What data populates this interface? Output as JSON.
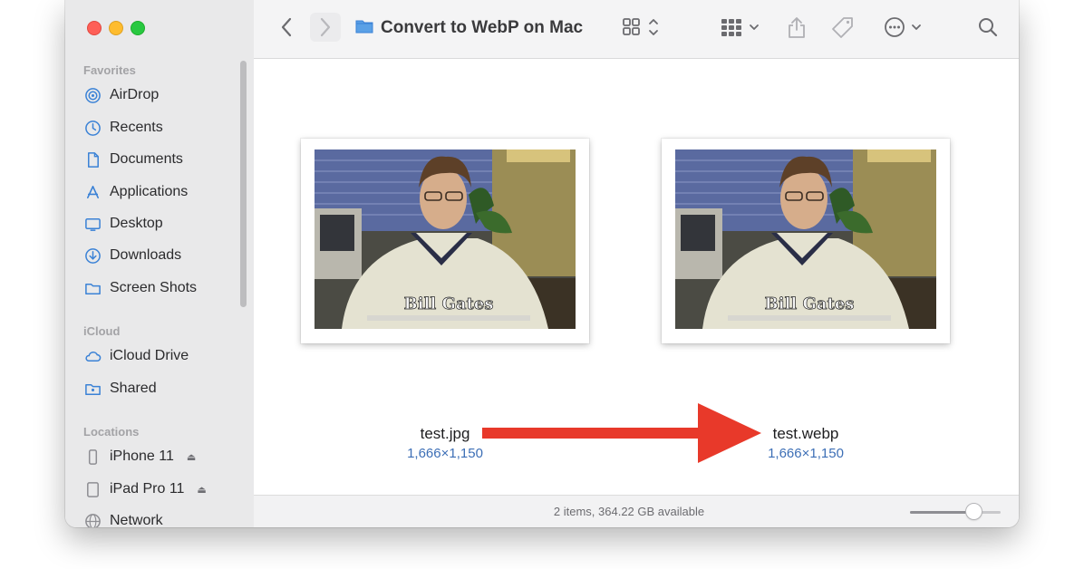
{
  "window": {
    "title": "Convert to WebP on Mac",
    "status": "2 items, 364.22 GB available",
    "zoom_level": 0.7
  },
  "sidebar": {
    "favorites_label": "Favorites",
    "favorites": [
      {
        "label": "AirDrop",
        "icon": "airdrop-icon"
      },
      {
        "label": "Recents",
        "icon": "clock-icon"
      },
      {
        "label": "Documents",
        "icon": "document-icon"
      },
      {
        "label": "Applications",
        "icon": "applications-icon"
      },
      {
        "label": "Desktop",
        "icon": "desktop-icon"
      },
      {
        "label": "Downloads",
        "icon": "download-icon"
      },
      {
        "label": "Screen Shots",
        "icon": "folder-icon"
      }
    ],
    "icloud_label": "iCloud",
    "icloud": [
      {
        "label": "iCloud Drive",
        "icon": "cloud-icon"
      },
      {
        "label": "Shared",
        "icon": "shared-folder-icon"
      }
    ],
    "locations_label": "Locations",
    "locations": [
      {
        "label": "iPhone 11",
        "icon": "phone-icon",
        "eject": "⏏"
      },
      {
        "label": "iPad Pro 11",
        "icon": "tablet-icon",
        "eject": "⏏"
      },
      {
        "label": "Network",
        "icon": "globe-icon"
      }
    ]
  },
  "files": [
    {
      "name": "test.jpg",
      "dimensions": "1,666×1,150",
      "caption": "Bill Gates"
    },
    {
      "name": "test.webp",
      "dimensions": "1,666×1,150",
      "caption": "Bill Gates"
    }
  ],
  "colors": {
    "accent": "#3d6fb6",
    "arrow": "#e8392a",
    "sidebar_icon": "#3b82d6"
  }
}
